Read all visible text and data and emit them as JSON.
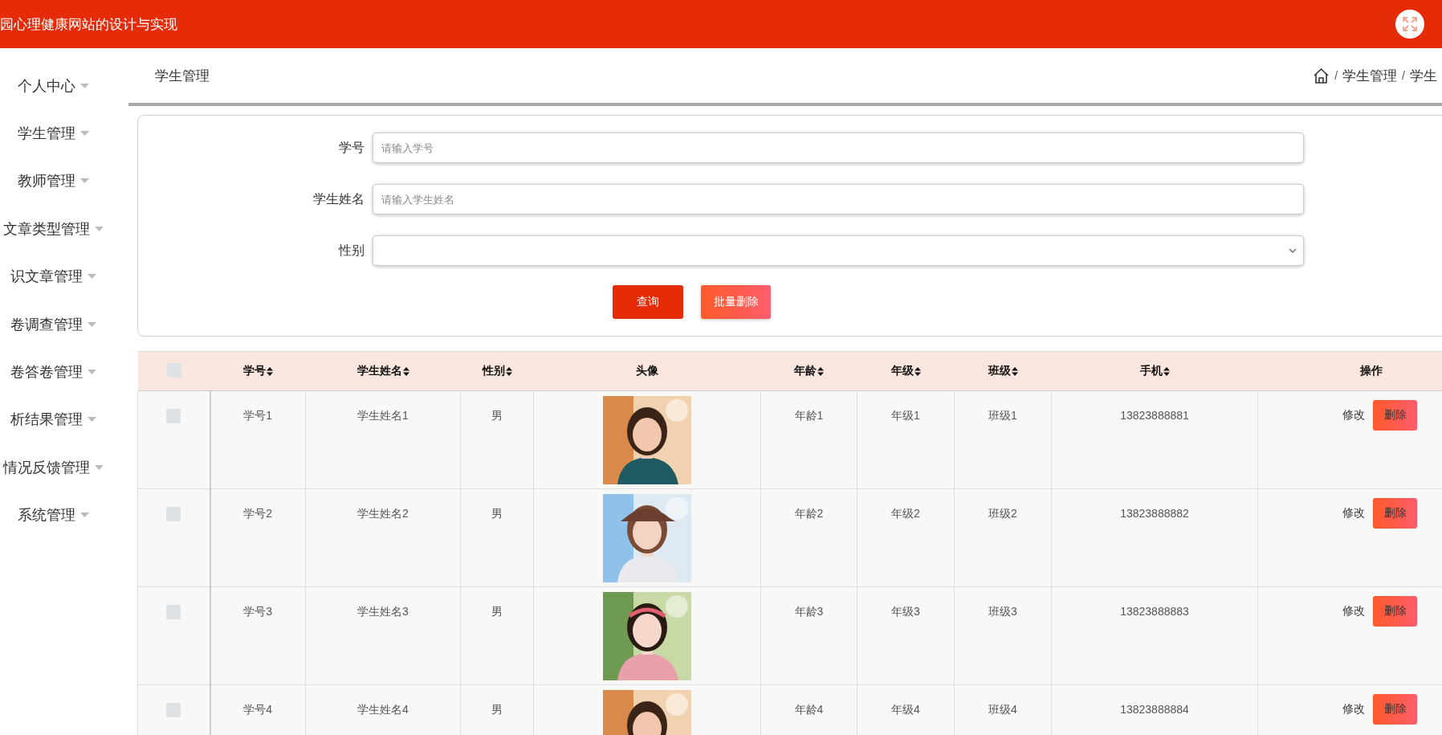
{
  "header": {
    "title": "园心理健康网站的设计与实现"
  },
  "sidebar": {
    "items": [
      {
        "label": "个人中心"
      },
      {
        "label": "学生管理"
      },
      {
        "label": "教师管理"
      },
      {
        "label": "文章类型管理"
      },
      {
        "label": "识文章管理"
      },
      {
        "label": "卷调查管理"
      },
      {
        "label": "卷答卷管理"
      },
      {
        "label": "析结果管理"
      },
      {
        "label": "情况反馈管理"
      },
      {
        "label": "系统管理"
      }
    ]
  },
  "page": {
    "title": "学生管理",
    "separator": "/",
    "breadcrumb": [
      "学生管理",
      "学生"
    ]
  },
  "search_form": {
    "fields": [
      {
        "label": "学号",
        "kind": "text",
        "placeholder": "请输入学号"
      },
      {
        "label": "学生姓名",
        "kind": "text",
        "placeholder": "请输入学生姓名"
      },
      {
        "label": "性别",
        "kind": "select"
      }
    ],
    "buttons": [
      {
        "label": "查询",
        "kind": "primary"
      },
      {
        "label": "批量删除",
        "kind": "danger"
      }
    ]
  },
  "table": {
    "select_all": {
      "checked": false
    },
    "columns": [
      {
        "label": "学号",
        "sortable": true
      },
      {
        "label": "学生姓名",
        "sortable": true
      },
      {
        "label": "性别",
        "sortable": true
      },
      {
        "label": "头像",
        "sortable": false
      },
      {
        "label": "年龄",
        "sortable": true
      },
      {
        "label": "年级",
        "sortable": true
      },
      {
        "label": "班级",
        "sortable": true
      },
      {
        "label": "手机",
        "sortable": true
      },
      {
        "label": "操作",
        "sortable": false
      }
    ],
    "rows": [
      {
        "checked": false,
        "student_id": "学号1",
        "name": "学生姓名1",
        "gender": "男",
        "age": "年龄1",
        "grade": "年级1",
        "class": "班级1",
        "phone": "13823888881",
        "edit": "修改",
        "delete": "删除"
      },
      {
        "checked": false,
        "student_id": "学号2",
        "name": "学生姓名2",
        "gender": "男",
        "age": "年龄2",
        "grade": "年级2",
        "class": "班级2",
        "phone": "13823888882",
        "edit": "修改",
        "delete": "删除"
      },
      {
        "checked": false,
        "student_id": "学号3",
        "name": "学生姓名3",
        "gender": "男",
        "age": "年龄3",
        "grade": "年级3",
        "class": "班级3",
        "phone": "13823888883",
        "edit": "修改",
        "delete": "删除"
      },
      {
        "checked": false,
        "student_id": "学号4",
        "name": "学生姓名4",
        "gender": "男",
        "age": "年龄4",
        "grade": "年级4",
        "class": "班级4",
        "phone": "13823888884",
        "edit": "修改",
        "delete": "删除"
      }
    ]
  }
}
